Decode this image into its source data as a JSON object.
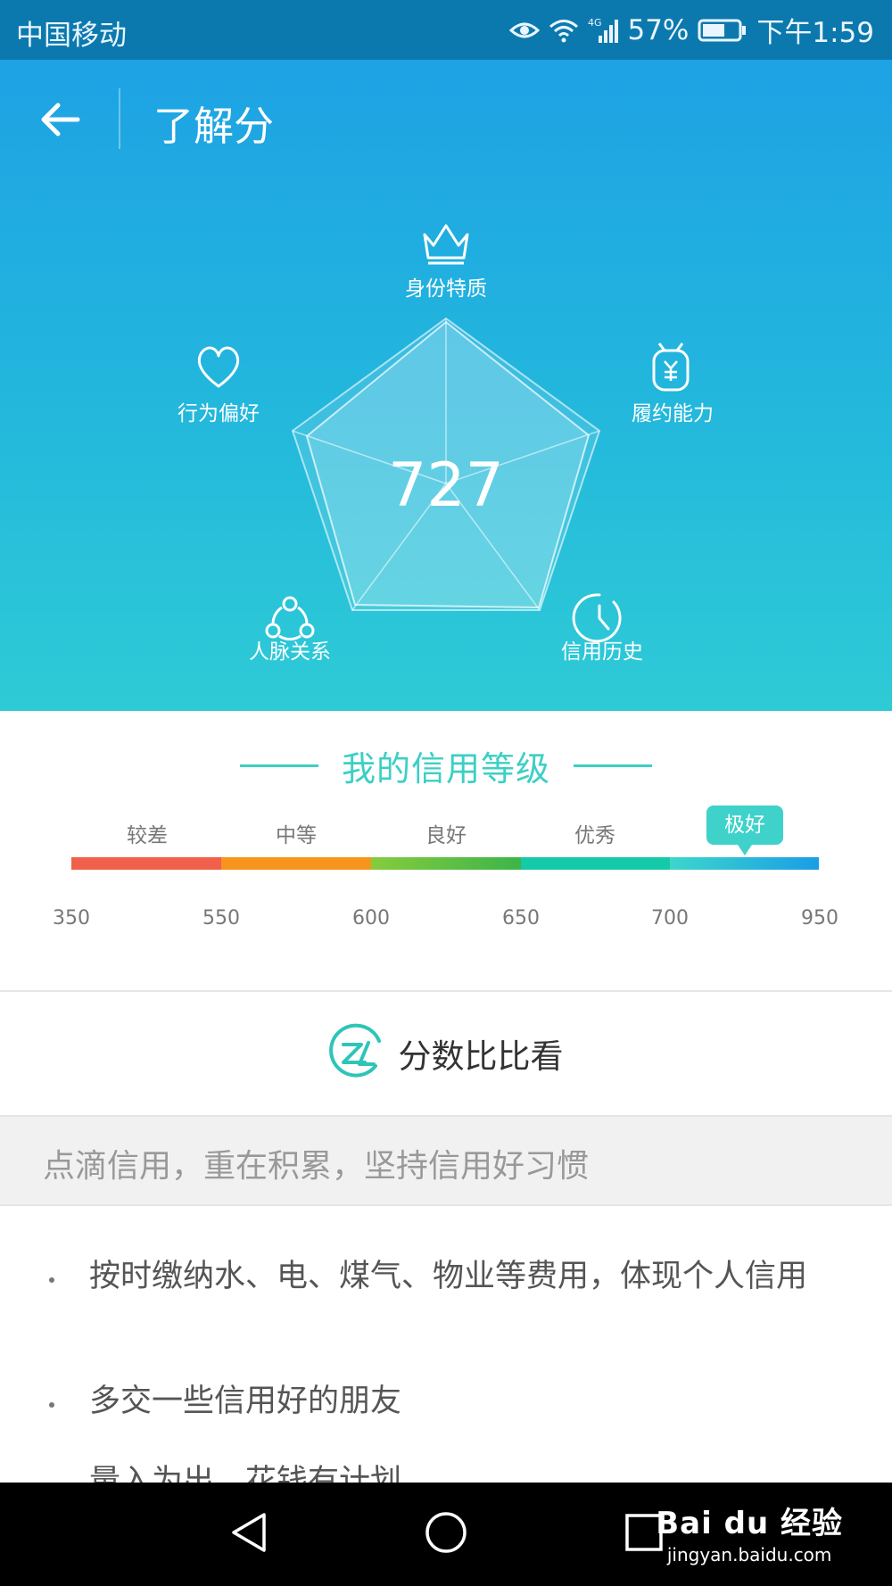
{
  "status_bar": {
    "carrier": "中国移动",
    "network": "4G",
    "battery": "57%",
    "time": "下午1:59"
  },
  "header": {
    "title": "了解分",
    "back_icon": "arrow-left-icon"
  },
  "radar": {
    "score": "727",
    "dimensions": [
      {
        "label": "身份特质",
        "icon": "crown-icon"
      },
      {
        "label": "履约能力",
        "icon": "money-bag-icon"
      },
      {
        "label": "信用历史",
        "icon": "clock-icon"
      },
      {
        "label": "人脉关系",
        "icon": "network-icon"
      },
      {
        "label": "行为偏好",
        "icon": "heart-icon"
      }
    ]
  },
  "credit_level": {
    "title": "我的信用等级",
    "grades": [
      "较差",
      "中等",
      "良好",
      "优秀",
      "极好"
    ],
    "selected_grade": "极好",
    "ticks": [
      "350",
      "550",
      "600",
      "650",
      "700",
      "950"
    ],
    "colors": [
      "#f0604a",
      "#f7941d",
      "#6cc644",
      "#1bc9a6",
      "#36c3e6"
    ]
  },
  "compare": {
    "label": "分数比比看",
    "icon": "zm-logo-icon"
  },
  "tip_header": "点滴信用，重在积累，坚持信用好习惯",
  "tips": [
    "按时缴纳水、电、煤气、物业等费用，体现个人信用",
    "多交一些信用好的朋友",
    "量入为出，花钱有计划"
  ],
  "nav": {
    "back": "nav-back-icon",
    "home": "nav-home-icon",
    "recents": "nav-recents-icon"
  },
  "watermark": {
    "main": "Bai du 经验",
    "sub": "jingyan.baidu.com"
  }
}
